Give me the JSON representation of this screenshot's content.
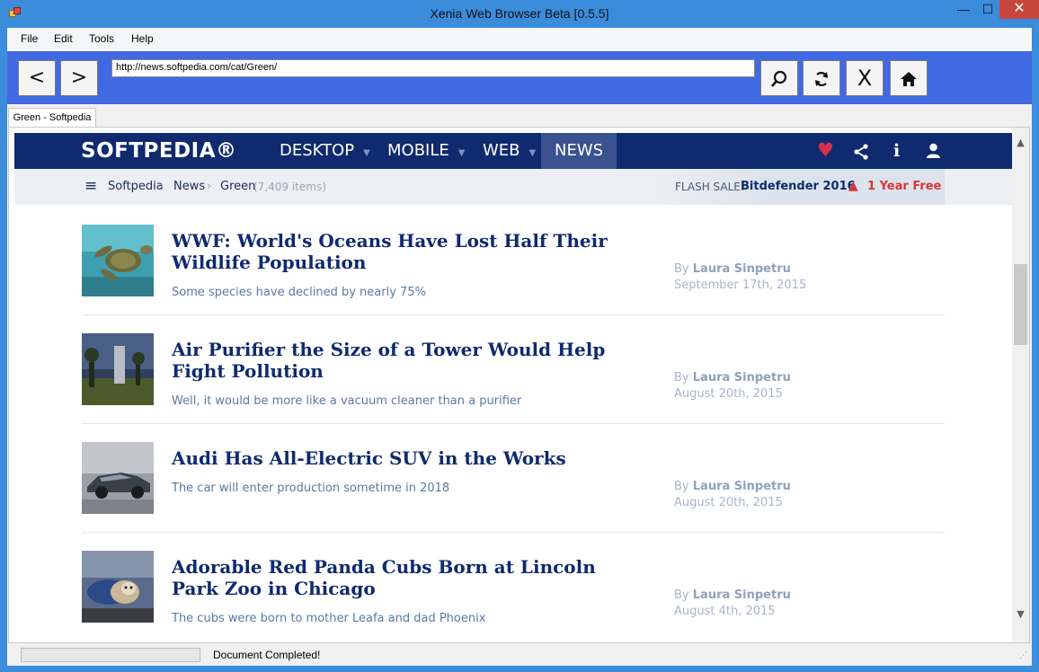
{
  "window": {
    "title": "Xenia Web Browser Beta [0.5.5]",
    "min_glyph": "—",
    "max_glyph": "☐",
    "close_glyph": "✕"
  },
  "menu": {
    "file": "File",
    "edit": "Edit",
    "tools": "Tools",
    "help": "Help"
  },
  "toolbar": {
    "back": "<",
    "forward": ">",
    "url": "http://news.softpedia.com/cat/Green/",
    "search_glyph": "⚲",
    "refresh_glyph": "⟳",
    "stop": "X",
    "home_glyph": "⌂"
  },
  "tab": {
    "label": "Green - Softpedia"
  },
  "page": {
    "logo": "SOFTPEDIA®",
    "nav": {
      "desktop": "DESKTOP",
      "mobile": "MOBILE",
      "web": "WEB",
      "news": "NEWS",
      "caret": "▼"
    },
    "icons": {
      "heart": "♥",
      "share": "⋖",
      "info": "i",
      "user": "👤"
    },
    "breadcrumb": {
      "menu_glyph": "≡",
      "home": "Softpedia",
      "sep": "›",
      "news": "News",
      "green": "Green",
      "count": "(7,409 items)"
    },
    "flash": {
      "label": "FLASH SALE:",
      "product": "Bitdefender 2016",
      "warn_glyph": "▲",
      "offer": "1 Year Free"
    },
    "articles": [
      {
        "headline": "WWF: World's Oceans Have Lost Half Their Wildlife Population",
        "teaser": "Some species have declined by nearly 75%",
        "by": "By",
        "author": "Laura Sinpetru",
        "date": "September 17th, 2015"
      },
      {
        "headline": "Air Purifier the Size of a Tower Would Help Fight Pollution",
        "teaser": "Well, it would be more like a vacuum cleaner than a purifier",
        "by": "By",
        "author": "Laura Sinpetru",
        "date": "August 20th, 2015"
      },
      {
        "headline": "Audi Has All-Electric SUV in the Works",
        "teaser": "The car will enter production sometime in 2018",
        "by": "By",
        "author": "Laura Sinpetru",
        "date": "August 20th, 2015"
      },
      {
        "headline": "Adorable Red Panda Cubs Born at Lincoln Park Zoo in Chicago",
        "teaser": "The cubs were born to mother Leafa and dad Phoenix",
        "by": "By",
        "author": "Laura Sinpetru",
        "date": "August 4th, 2015"
      }
    ]
  },
  "scrollbar": {
    "up_glyph": "▲",
    "down_glyph": "▼"
  },
  "status": {
    "text": "Document Completed!",
    "progress": 0,
    "grip": "⋰"
  },
  "colors": {
    "toolbar": "#4169e1",
    "titlebar": "#3c8cdc",
    "nav": "#0f2a6e",
    "accent_red": "#d23a3a"
  }
}
